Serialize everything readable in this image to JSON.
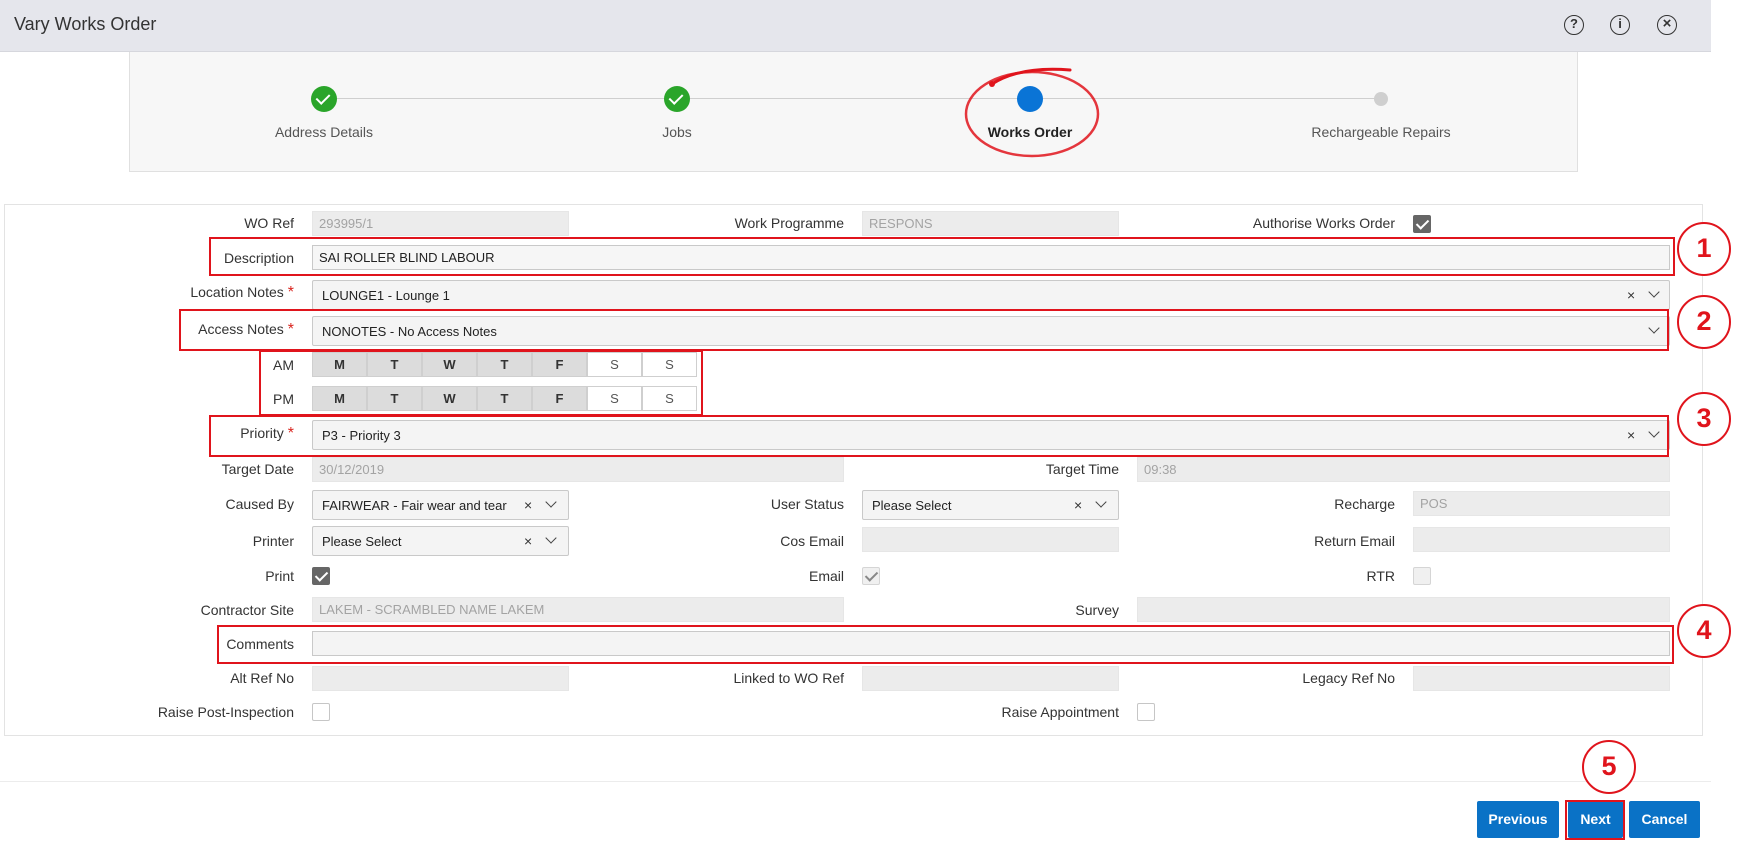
{
  "window": {
    "title": "Vary Works Order",
    "icons": [
      "help-icon",
      "info-icon",
      "close-icon"
    ],
    "icon_glyphs": [
      "?",
      "i",
      "×"
    ]
  },
  "steps": [
    {
      "label": "Address Details",
      "state": "complete"
    },
    {
      "label": "Jobs",
      "state": "complete"
    },
    {
      "label": "Works Order",
      "state": "active"
    },
    {
      "label": "Rechargeable Repairs",
      "state": "pending"
    }
  ],
  "form": {
    "wo_ref": {
      "label": "WO Ref",
      "value": "293995/1"
    },
    "work_programme": {
      "label": "Work Programme",
      "value": "RESPONS"
    },
    "authorise": {
      "label": "Authorise Works Order",
      "checked": true
    },
    "description": {
      "label": "Description",
      "value": "SAI ROLLER BLIND LABOUR"
    },
    "location_notes": {
      "label": "Location Notes",
      "value": "LOUNGE1 - Lounge 1",
      "required": "*"
    },
    "access_notes": {
      "label": "Access Notes",
      "value": "NONOTES - No Access Notes",
      "required": "*"
    },
    "availability": {
      "am_label": "AM",
      "pm_label": "PM",
      "days": [
        "M",
        "T",
        "W",
        "T",
        "F",
        "S",
        "S"
      ],
      "am_selected": [
        true,
        true,
        true,
        true,
        true,
        false,
        false
      ],
      "pm_selected": [
        true,
        true,
        true,
        true,
        true,
        false,
        false
      ]
    },
    "priority": {
      "label": "Priority",
      "value": "P3 - Priority 3",
      "required": "*"
    },
    "target_date": {
      "label": "Target Date",
      "value": "30/12/2019"
    },
    "target_time": {
      "label": "Target Time",
      "value": "09:38"
    },
    "caused_by": {
      "label": "Caused By",
      "value": "FAIRWEAR - Fair wear and tear"
    },
    "user_status": {
      "label": "User Status",
      "value": "Please Select"
    },
    "recharge": {
      "label": "Recharge",
      "value": "POS"
    },
    "printer": {
      "label": "Printer",
      "value": "Please Select"
    },
    "cos_email": {
      "label": "Cos Email",
      "value": ""
    },
    "return_email": {
      "label": "Return Email",
      "value": ""
    },
    "print": {
      "label": "Print",
      "checked": true
    },
    "email": {
      "label": "Email",
      "checked": true
    },
    "rtr": {
      "label": "RTR",
      "checked": false
    },
    "contractor_site": {
      "label": "Contractor Site",
      "value": "LAKEM - SCRAMBLED NAME LAKEM"
    },
    "survey": {
      "label": "Survey",
      "value": ""
    },
    "comments": {
      "label": "Comments",
      "value": ""
    },
    "alt_ref_no": {
      "label": "Alt Ref No",
      "value": ""
    },
    "linked_wo_ref": {
      "label": "Linked to WO Ref",
      "value": ""
    },
    "legacy_ref_no": {
      "label": "Legacy Ref No",
      "value": ""
    },
    "raise_post_inspection": {
      "label": "Raise Post-Inspection",
      "checked": false
    },
    "raise_appointment": {
      "label": "Raise Appointment",
      "checked": false
    }
  },
  "clear_glyph": "×",
  "annotations": [
    "1",
    "2",
    "3",
    "4",
    "5"
  ],
  "buttons": {
    "previous": "Previous",
    "next": "Next",
    "cancel": "Cancel"
  },
  "colors": {
    "accent": "#0a72c6",
    "complete": "#2aa52a",
    "active_step": "#0a74d6",
    "highlight": "#e0141c"
  }
}
